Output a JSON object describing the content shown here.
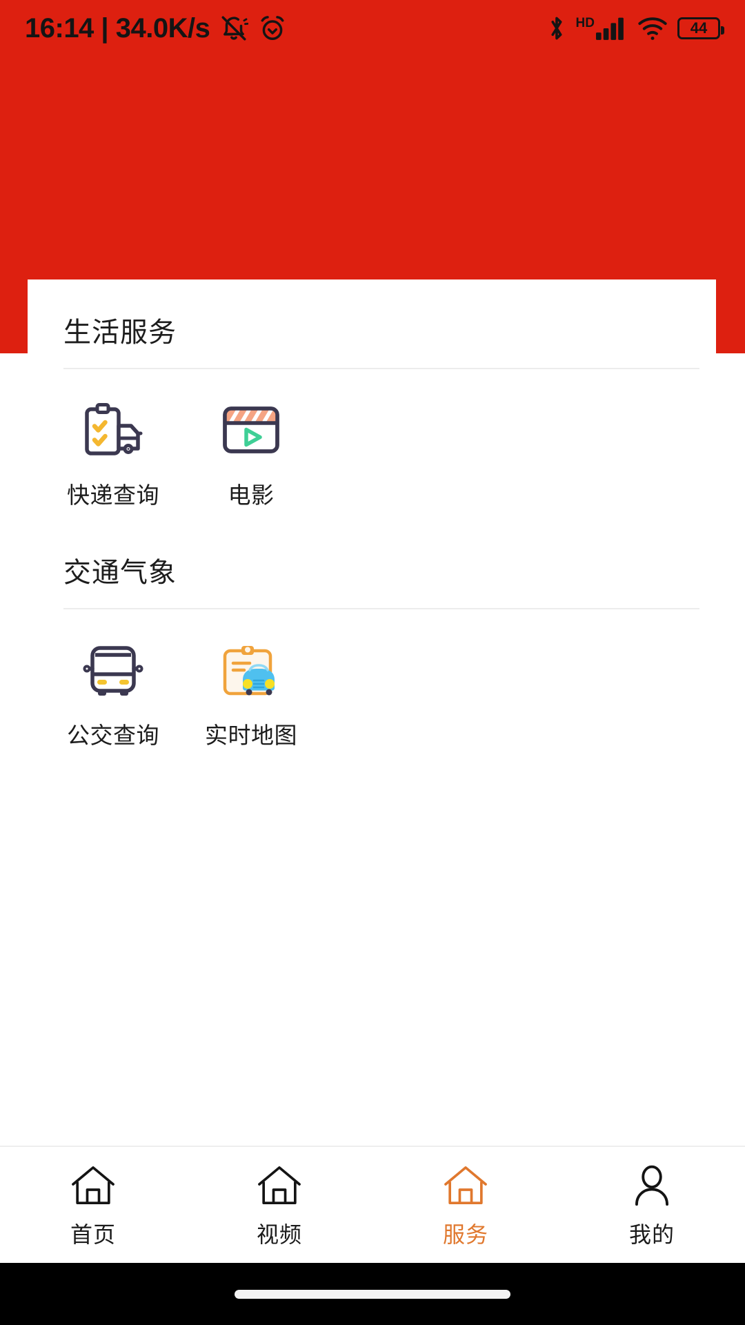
{
  "status_bar": {
    "time": "16:14",
    "separator": "|",
    "network_speed": "34.0K/s",
    "time_full": "16:14 | 34.0K/s",
    "icons_left": [
      "mute-icon",
      "alarm-icon"
    ],
    "icons_right": [
      "bluetooth-icon",
      "hd-icon",
      "signal-icon",
      "wifi-icon",
      "battery-icon"
    ],
    "hd_label": "HD",
    "battery_level": "44"
  },
  "theme": {
    "banner_red": "#dd2010",
    "accent_orange": "#e0782e",
    "text_dark": "#1d1d1d",
    "divider": "#ececec"
  },
  "sections": [
    {
      "title": "生活服务",
      "items": [
        {
          "label": "快递查询",
          "icon": "express-delivery-icon"
        },
        {
          "label": "电影",
          "icon": "movie-clapperboard-icon"
        }
      ]
    },
    {
      "title": "交通气象",
      "items": [
        {
          "label": "公交查询",
          "icon": "bus-icon"
        },
        {
          "label": "实时地图",
          "icon": "realtime-map-car-icon"
        }
      ]
    }
  ],
  "bottom_nav": {
    "items": [
      {
        "label": "首页",
        "icon": "home-icon",
        "active": false
      },
      {
        "label": "视频",
        "icon": "video-home-icon",
        "active": false
      },
      {
        "label": "服务",
        "icon": "service-home-icon",
        "active": true
      },
      {
        "label": "我的",
        "icon": "person-icon",
        "active": false
      }
    ]
  }
}
